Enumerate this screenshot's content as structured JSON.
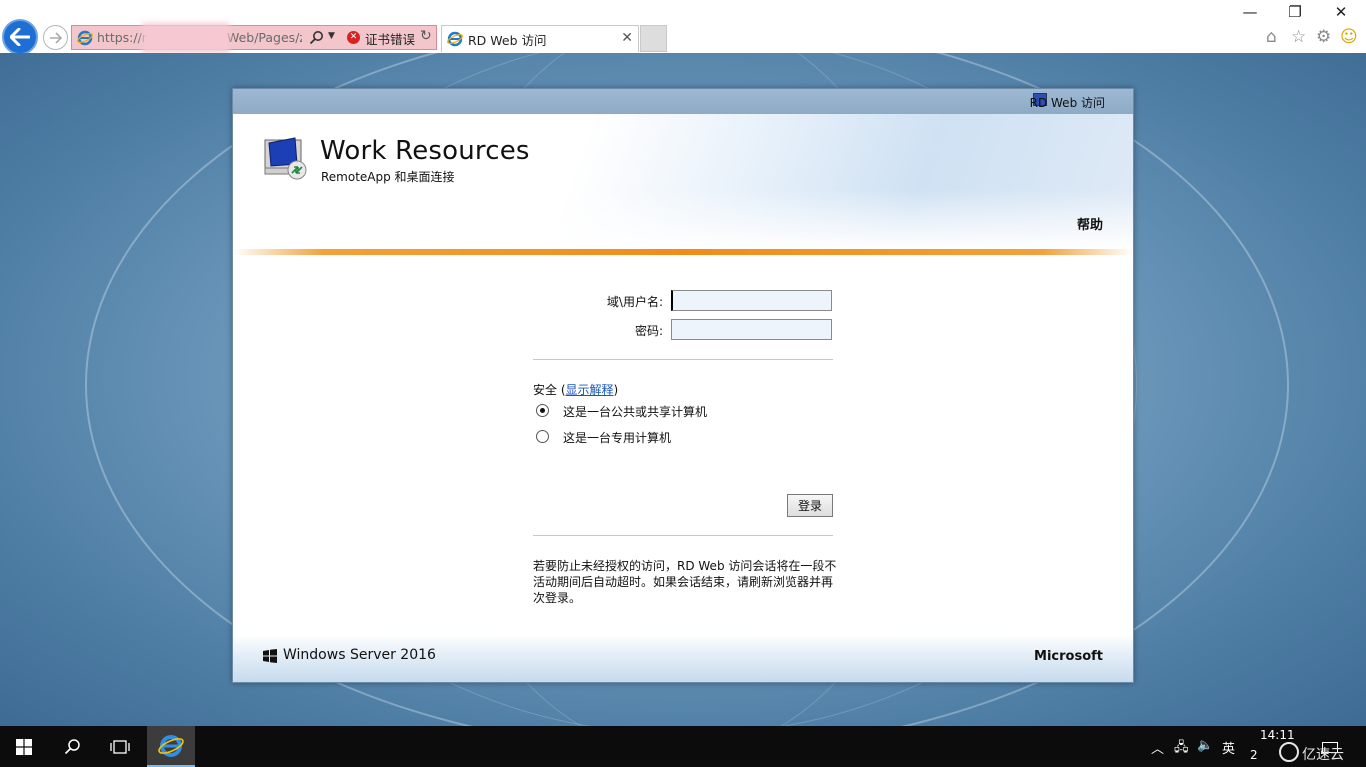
{
  "browser": {
    "url": "https://r",
    "url_tail": "Web/Pages/z",
    "cert_error": "证书错误",
    "tab_title": "RD Web 访问"
  },
  "card": {
    "top_label": "RD Web 访问",
    "title": "Work Resources",
    "subtitle": "RemoteApp 和桌面连接",
    "help": "帮助"
  },
  "form": {
    "username_label": "域\\用户名:",
    "username_value": "",
    "password_label": "密码:",
    "password_value": "",
    "security_label": "安全 (",
    "security_link": "显示解释",
    "security_close": ")",
    "option_public": "这是一台公共或共享计算机",
    "option_private": "这是一台专用计算机",
    "selected_option": "public",
    "login_button": "登录",
    "note": "若要防止未经授权的访问，RD Web 访问会话将在一段不活动期间后自动超时。如果会话结束，请刷新浏览器并再次登录。"
  },
  "footer": {
    "left": "Windows Server 2016",
    "right": "Microsoft"
  },
  "taskbar": {
    "ime": "英",
    "time": "14:11",
    "date_fragment": "2"
  },
  "watermark": "亿速云",
  "colors": {
    "back_button": "#1e6fd4",
    "address_error": "#f3c6cc",
    "accent_orange": "#ef8d1a",
    "link": "#1a57b8",
    "taskbar": "#0c0c0c"
  }
}
